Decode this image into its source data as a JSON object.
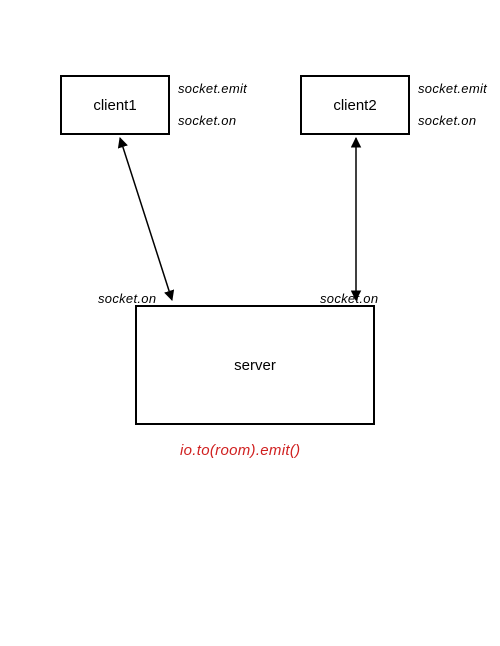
{
  "diagram": {
    "boxes": {
      "client1": "client1",
      "client2": "client2",
      "server": "server"
    },
    "labels": {
      "client1_emit": "socket.emit",
      "client1_on": "socket.on",
      "client2_emit": "socket.emit",
      "client2_on": "socket.on",
      "server_left_on": "socket.on",
      "server_right_on": "socket.on",
      "server_bottom": "io.to(room).emit()"
    }
  },
  "chart_data": {
    "type": "diagram",
    "nodes": [
      {
        "id": "client1",
        "label": "client1",
        "api": [
          "socket.emit",
          "socket.on"
        ]
      },
      {
        "id": "client2",
        "label": "client2",
        "api": [
          "socket.emit",
          "socket.on"
        ]
      },
      {
        "id": "server",
        "label": "server",
        "api_in": "socket.on",
        "api_out": "io.to(room).emit()"
      }
    ],
    "edges": [
      {
        "from": "client1",
        "to": "server",
        "bidirectional": true
      },
      {
        "from": "client2",
        "to": "server",
        "bidirectional": true
      }
    ]
  }
}
